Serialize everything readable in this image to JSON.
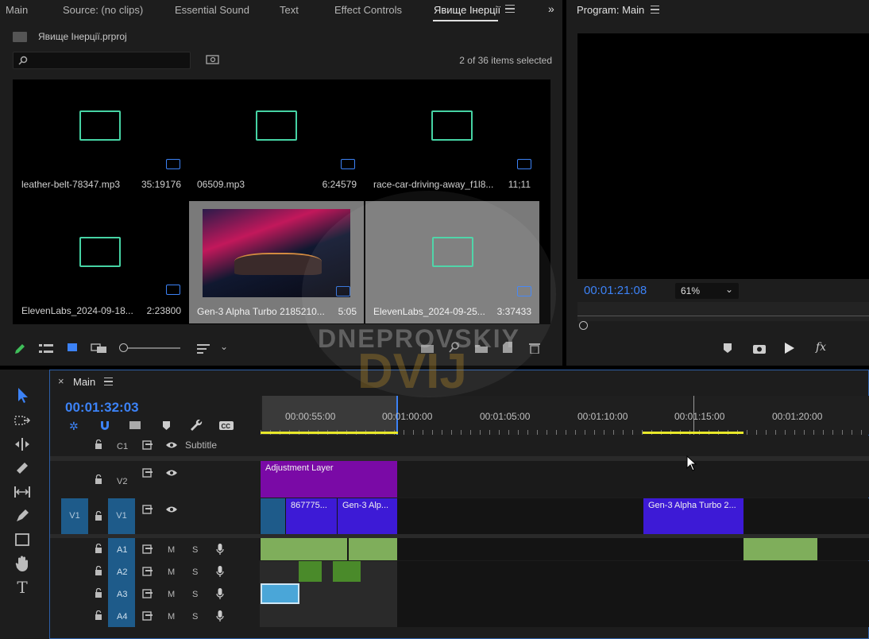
{
  "tabs": [
    "Main",
    "Source: (no clips)",
    "Essential Sound",
    "Text",
    "Effect Controls",
    "Явище Інерції"
  ],
  "project": {
    "filename": "Явище Інерції.prproj",
    "selection_count": "2 of 36 items selected",
    "items": [
      {
        "name": "leather-belt-78347.mp3",
        "duration": "35:19176",
        "type": "audio"
      },
      {
        "name": "06509.mp3",
        "duration": "6:24579",
        "type": "audio"
      },
      {
        "name": "race-car-driving-away_f1l8...",
        "duration": "11;11",
        "type": "audio"
      },
      {
        "name": "ElevenLabs_2024-09-18...",
        "duration": "2:23800",
        "type": "audio"
      },
      {
        "name": "Gen-3 Alpha Turbo 2185210...",
        "duration": "5:05",
        "type": "video"
      },
      {
        "name": "ElevenLabs_2024-09-25...",
        "duration": "3:37433",
        "type": "audio"
      }
    ]
  },
  "program": {
    "title": "Program: Main",
    "timecode": "00:01:21:08",
    "zoom": "61%"
  },
  "watermark": {
    "line1": "DNEPROVSKIY",
    "line2": "DVIJ"
  },
  "timeline": {
    "tab": "Main",
    "timecode": "00:01:32:03",
    "ruler": [
      "00:00:55:00",
      "00:01:00:00",
      "00:01:05:00",
      "00:01:10:00",
      "00:01:15:00",
      "00:01:20:00"
    ],
    "tracks": {
      "c1": "C1",
      "subtitle": "Subtitle",
      "v2": "V2",
      "v1": "V1",
      "v1src": "V1",
      "a1": "A1",
      "a2": "A2",
      "a3": "A3",
      "a4": "A4",
      "m": "M",
      "s": "S"
    },
    "clips": {
      "adjustment": "Adjustment Layer",
      "clip1": "867775...",
      "clip2": "Gen-3 Alp...",
      "clip3": "Gen-3 Alpha Turbo 2..."
    }
  },
  "colors": {
    "accent": "#3c82f6",
    "audio_icon": "#46d3a4",
    "adjustment": "#7a0aa6",
    "video_clip": "#3d1ad6",
    "audio_clip": "#7fae5b",
    "track_blue": "#1e5b8a",
    "ruler_yellow": "#e8e82a"
  }
}
